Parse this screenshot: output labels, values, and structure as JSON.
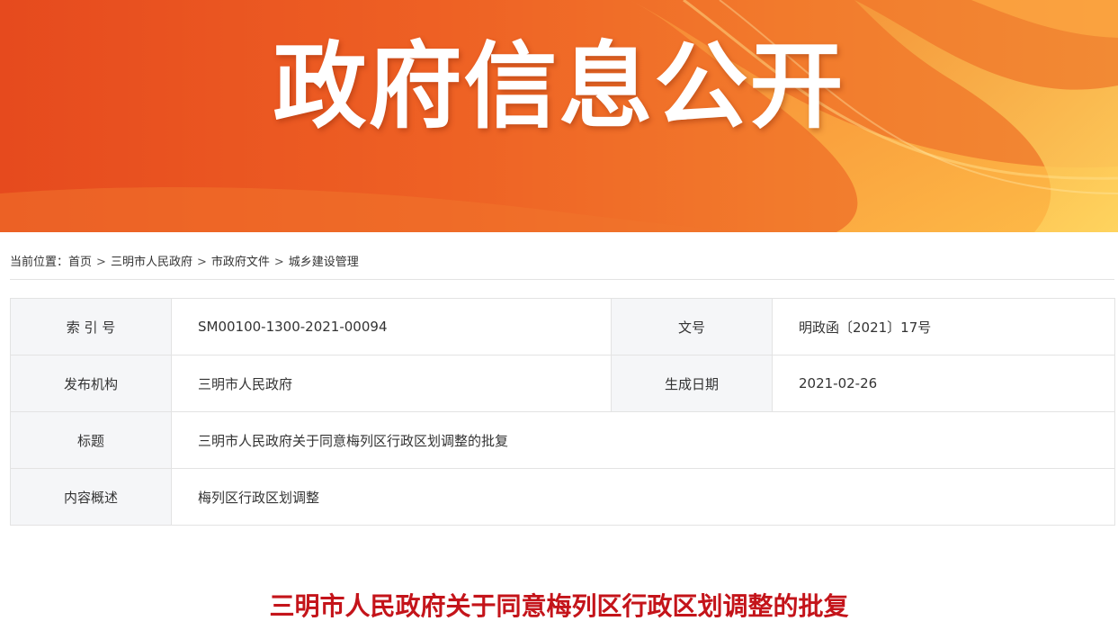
{
  "banner": {
    "title": "政府信息公开"
  },
  "breadcrumb": {
    "prefix": "当前位置：",
    "items": [
      "首页",
      "三明市人民政府",
      "市政府文件",
      "城乡建设管理"
    ],
    "separator": ">"
  },
  "info": {
    "index_label": "索 引 号",
    "index_value": "SM00100-1300-2021-00094",
    "docno_label": "文号",
    "docno_value": "明政函〔2021〕17号",
    "publisher_label": "发布机构",
    "publisher_value": "三明市人民政府",
    "date_label": "生成日期",
    "date_value": "2021-02-26",
    "title_label": "标题",
    "title_value": "三明市人民政府关于同意梅列区行政区划调整的批复",
    "summary_label": "内容概述",
    "summary_value": "梅列区行政区划调整"
  },
  "document": {
    "title": "三明市人民政府关于同意梅列区行政区划调整的批复"
  },
  "colors": {
    "banner_orange": "#ee6124",
    "banner_yellow": "#ffd25a",
    "title_red": "#c4141a",
    "label_bg": "#f5f6f8",
    "border": "#e3e3e3"
  }
}
